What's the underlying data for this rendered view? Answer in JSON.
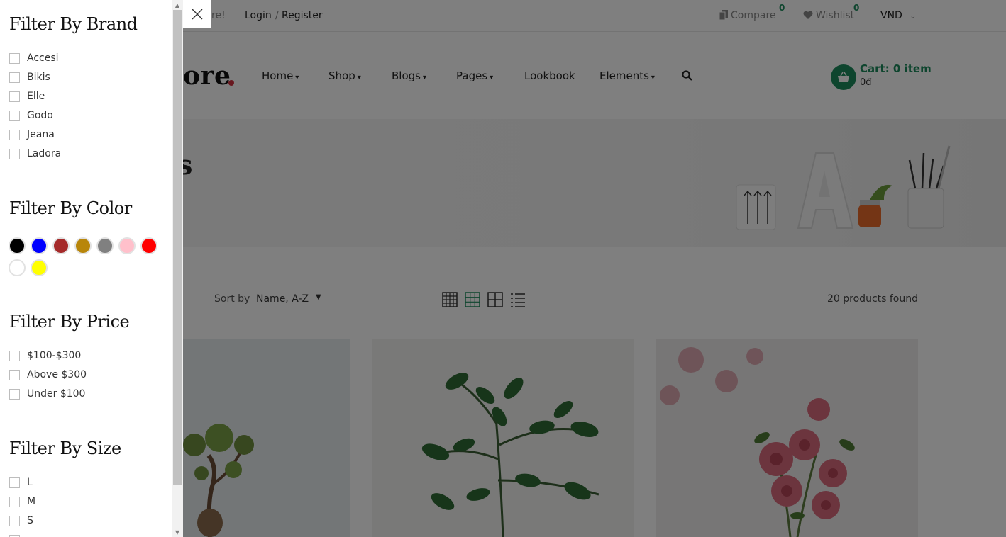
{
  "topbar": {
    "promo_fragment": "tore!",
    "login": "Login",
    "separator": "/",
    "register": "Register",
    "compare": "Compare",
    "compare_count": "0",
    "wishlist": "Wishlist",
    "wishlist_count": "0",
    "currency": "VND",
    "currency_caret": "⌄"
  },
  "header": {
    "logo_fragment": "ore",
    "nav": [
      {
        "label": "Home"
      },
      {
        "label": "Shop"
      },
      {
        "label": "Blogs"
      },
      {
        "label": "Pages"
      },
      {
        "label": "Lookbook"
      },
      {
        "label": "Elements"
      }
    ],
    "cart_title": "Cart: 0 item",
    "cart_total": "0₫"
  },
  "hero": {
    "title_fragment": "s"
  },
  "toolbar": {
    "sort_label": "Sort by",
    "sort_value": "Name, A-Z",
    "products_found": "20 products found"
  },
  "sidebar": {
    "brand": {
      "heading": "Filter By Brand",
      "items": [
        "Accesi",
        "Bikis",
        "Elle",
        "Godo",
        "Jeana",
        "Ladora"
      ]
    },
    "color": {
      "heading": "Filter By Color",
      "swatches": [
        "#000000",
        "#0000ff",
        "#a52a2a",
        "#b8860b",
        "#808080",
        "#ffc0cb",
        "#ff0000",
        "#ffffff",
        "#ffff00"
      ]
    },
    "price": {
      "heading": "Filter By Price",
      "items": [
        "$100-$300",
        "Above $300",
        "Under $100"
      ]
    },
    "size": {
      "heading": "Filter By Size",
      "items": [
        "L",
        "M",
        "S"
      ]
    }
  },
  "colors": {
    "accent": "#1d8a5c",
    "logo_dot": "#d0313f"
  }
}
